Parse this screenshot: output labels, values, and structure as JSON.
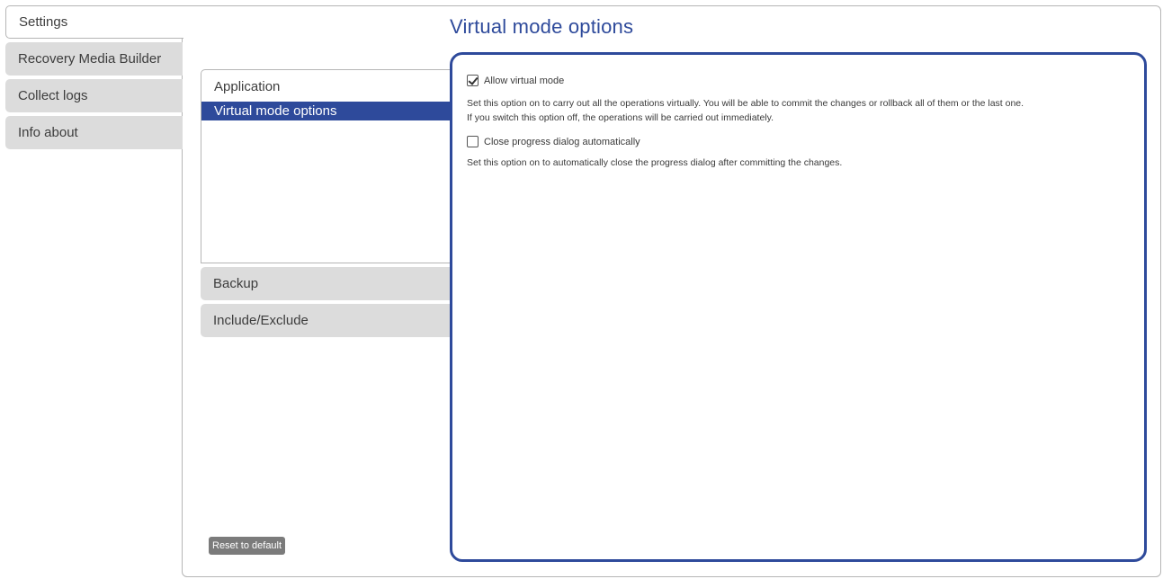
{
  "nav": {
    "items": [
      {
        "label": "Settings"
      },
      {
        "label": "Recovery Media Builder"
      },
      {
        "label": "Collect logs"
      },
      {
        "label": "Info about"
      }
    ]
  },
  "page": {
    "title": "Virtual mode options"
  },
  "categories": {
    "application": {
      "label": "Application",
      "items": [
        {
          "label": "Virtual mode options"
        }
      ]
    },
    "backup": {
      "label": "Backup"
    },
    "include_exclude": {
      "label": "Include/Exclude"
    }
  },
  "buttons": {
    "reset": "Reset to default"
  },
  "options": {
    "allow_virtual": {
      "label": "Allow virtual mode",
      "checked": true,
      "description_line1": "Set this option on to carry out all the operations virtually. You will be able to commit the changes or rollback all of them or the last one.",
      "description_line2": "If you switch this option off, the operations will be carried out immediately."
    },
    "close_progress": {
      "label": "Close progress dialog automatically",
      "checked": false,
      "description": "Set this option on to automatically close the progress dialog after committing the changes."
    }
  },
  "colors": {
    "accent": "#2e4a9b",
    "tab_inactive": "#dcdcdc",
    "button_gray": "#7b7b7b"
  }
}
